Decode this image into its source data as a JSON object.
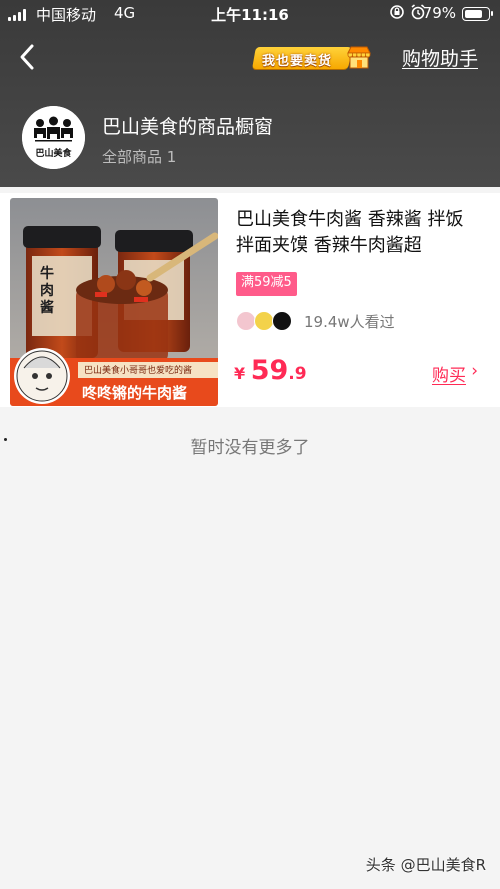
{
  "status_bar": {
    "carrier": "中国移动",
    "network": "4G",
    "time": "上午11:16",
    "battery": "79%",
    "battery_level": 0.79
  },
  "nav": {
    "back_icon": "chevron-left-icon",
    "seller_button": "我也要卖货",
    "assistant_link": "购物助手"
  },
  "shop": {
    "name": "巴山美食的商品橱窗",
    "subtitle": "全部商品 1",
    "logo_text": "巴山美食"
  },
  "product": {
    "title": "巴山美食牛肉酱 香辣酱 拌饭拌面夹馍 香辣牛肉酱超",
    "image_caption_top": "巴山美食小哥哥也爱吃的酱",
    "image_caption_main": "咚咚锵的牛肉酱",
    "image_jar_label": "牛肉酱",
    "promo": "满59减5",
    "viewers_text": "19.4w人看过",
    "currency": "¥",
    "price_int": "59",
    "price_dec": ".9",
    "buy_label": "购买",
    "buy_arrow": "›",
    "accent_color": "#ff2a55"
  },
  "footer": {
    "no_more": "暂时没有更多了",
    "watermark": "头条 @巴山美食R"
  }
}
